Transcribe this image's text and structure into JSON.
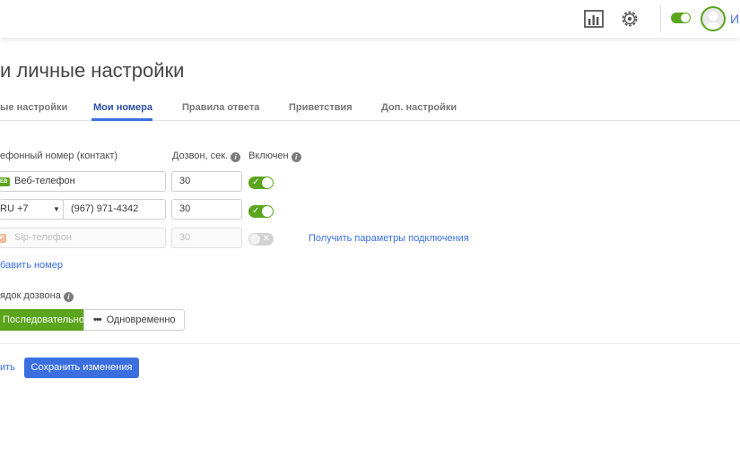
{
  "header": {
    "stats_icon": "bar-chart-icon",
    "settings_icon": "gear-icon",
    "user_initial": "И",
    "online_toggle_on": true
  },
  "page": {
    "title": "и личные настройки"
  },
  "tabs": [
    {
      "label": "ые настройки",
      "active": false
    },
    {
      "label": "Мои номера",
      "active": true
    },
    {
      "label": "Правила ответа",
      "active": false
    },
    {
      "label": "Приветствия",
      "active": false
    },
    {
      "label": "Доп. настройки",
      "active": false
    }
  ],
  "columns": {
    "phone": "ефонный номер (контакт)",
    "dial": "Дозвон, сек.",
    "enabled": "Включен"
  },
  "rows": [
    {
      "badge": "ЕВ",
      "value": "Веб-телефон",
      "dial": "30",
      "enabled": true
    },
    {
      "country": "RU +7",
      "value": "(967) 971-4342",
      "dial": "30",
      "enabled": true
    },
    {
      "badge": "Р",
      "placeholder": "Sip-телефон",
      "dial_placeholder": "30",
      "enabled": false,
      "link": "Получить параметры подключения"
    }
  ],
  "add_number": "бавить номер",
  "dial_order": {
    "label": "ядок дозвона",
    "options": [
      "Последовательно",
      "Одновременно"
    ],
    "selected": "Последовательно"
  },
  "actions": {
    "cancel": "ить",
    "save": "Сохранить изменения"
  },
  "colors": {
    "green": "#5aa51b",
    "blue": "#3b6fe0"
  }
}
